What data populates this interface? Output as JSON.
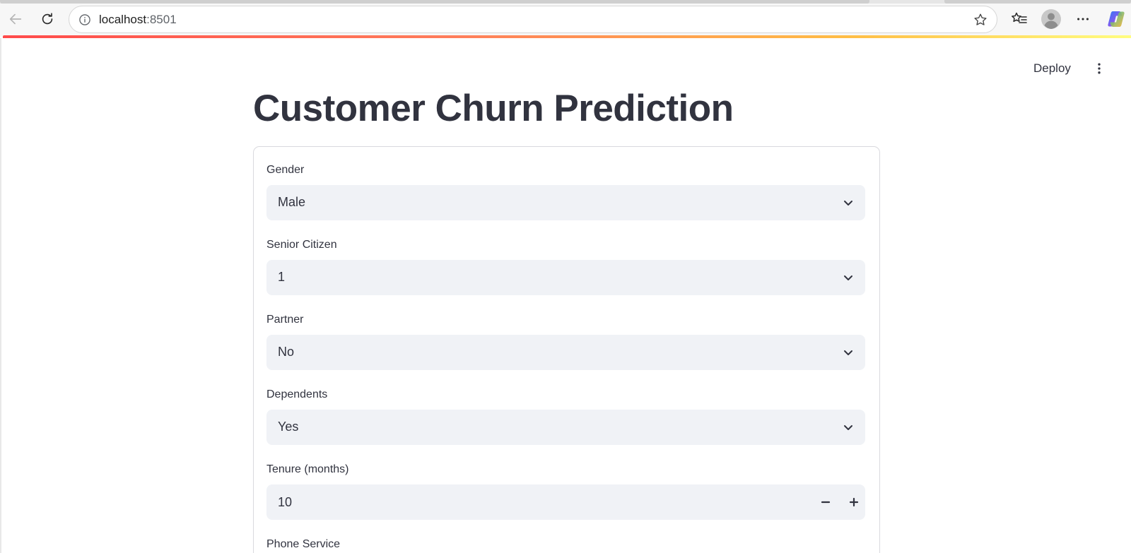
{
  "browser": {
    "url_host": "localhost",
    "url_port": ":8501"
  },
  "app": {
    "deploy_label": "Deploy",
    "title": "Customer Churn Prediction"
  },
  "form": {
    "gender": {
      "label": "Gender",
      "value": "Male"
    },
    "senior_citizen": {
      "label": "Senior Citizen",
      "value": "1"
    },
    "partner": {
      "label": "Partner",
      "value": "No"
    },
    "dependents": {
      "label": "Dependents",
      "value": "Yes"
    },
    "tenure": {
      "label": "Tenure (months)",
      "value": "10"
    },
    "phone_service": {
      "label": "Phone Service"
    }
  },
  "colors": {
    "text": "#31333f",
    "input_bg": "#f0f2f6",
    "accent": "#ff4b4b"
  }
}
